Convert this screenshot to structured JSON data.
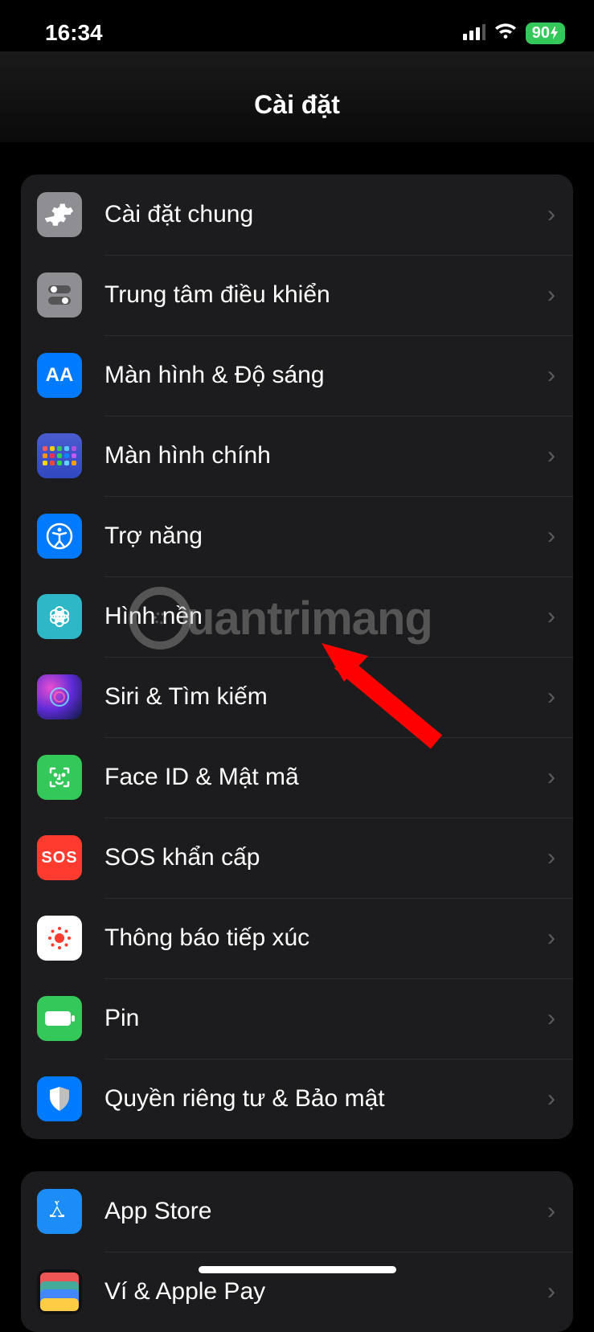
{
  "status": {
    "time": "16:34",
    "battery": "90"
  },
  "header": {
    "title": "Cài đặt"
  },
  "groups": [
    {
      "rows": [
        {
          "label": "Cài đặt chung",
          "icon": "gear-icon",
          "bg": "bg-gray"
        },
        {
          "label": "Trung tâm điều khiển",
          "icon": "control-center-icon",
          "bg": "bg-gray2"
        },
        {
          "label": "Màn hình & Độ sáng",
          "icon": "display-icon",
          "bg": "bg-blue"
        },
        {
          "label": "Màn hình chính",
          "icon": "home-screen-icon",
          "bg": "bg-blue2"
        },
        {
          "label": "Trợ năng",
          "icon": "accessibility-icon",
          "bg": "bg-blue"
        },
        {
          "label": "Hình nền",
          "icon": "wallpaper-icon",
          "bg": "bg-cyan"
        },
        {
          "label": "Siri & Tìm kiếm",
          "icon": "siri-icon",
          "bg": ""
        },
        {
          "label": "Face ID & Mật mã",
          "icon": "faceid-icon",
          "bg": "bg-green"
        },
        {
          "label": "SOS khẩn cấp",
          "icon": "sos-icon",
          "bg": "bg-red"
        },
        {
          "label": "Thông báo tiếp xúc",
          "icon": "exposure-icon",
          "bg": "bg-white"
        },
        {
          "label": "Pin",
          "icon": "battery-icon",
          "bg": "bg-green2"
        },
        {
          "label": "Quyền riêng tư & Bảo mật",
          "icon": "privacy-icon",
          "bg": "bg-blue"
        }
      ]
    },
    {
      "rows": [
        {
          "label": "App Store",
          "icon": "appstore-icon",
          "bg": "bg-app"
        },
        {
          "label": "Ví & Apple Pay",
          "icon": "wallet-icon",
          "bg": ""
        }
      ]
    }
  ],
  "sos_text": "SOS",
  "aa_text": "AA",
  "watermark": "uantrimang"
}
